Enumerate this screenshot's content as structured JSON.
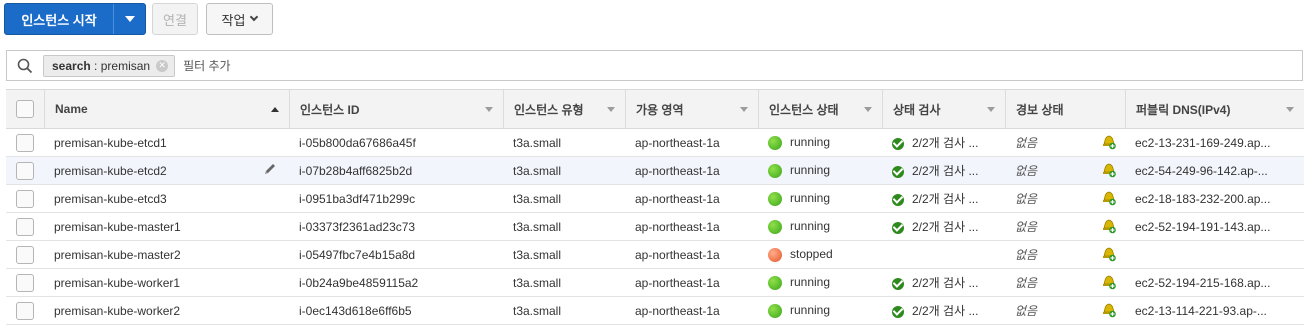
{
  "toolbar": {
    "launch_label": "인스턴스 시작",
    "connect_label": "연결",
    "actions_label": "작업"
  },
  "search": {
    "token_key": "search",
    "token_sep": ":",
    "token_value": "premisan",
    "placeholder": "필터 추가"
  },
  "columns": {
    "name": "Name",
    "instance_id": "인스턴스 ID",
    "instance_type": "인스턴스 유형",
    "az": "가용 영역",
    "instance_state": "인스턴스 상태",
    "status_checks": "상태 검사",
    "alarm_status": "경보 상태",
    "public_dns": "퍼블릭 DNS(IPv4)"
  },
  "rows": [
    {
      "name": "premisan-kube-etcd1",
      "id": "i-05b800da67686a45f",
      "type": "t3a.small",
      "az": "ap-northeast-1a",
      "state": "running",
      "state_color": "#3aa51a",
      "check": "2/2개 검사 ...",
      "alarm": "없음",
      "dns": "ec2-13-231-169-249.ap..."
    },
    {
      "name": "premisan-kube-etcd2",
      "id": "i-07b28b4aff6825b2d",
      "type": "t3a.small",
      "az": "ap-northeast-1a",
      "state": "running",
      "state_color": "#3aa51a",
      "check": "2/2개 검사 ...",
      "alarm": "없음",
      "dns": "ec2-54-249-96-142.ap-..."
    },
    {
      "name": "premisan-kube-etcd3",
      "id": "i-0951ba3df471b299c",
      "type": "t3a.small",
      "az": "ap-northeast-1a",
      "state": "running",
      "state_color": "#3aa51a",
      "check": "2/2개 검사 ...",
      "alarm": "없음",
      "dns": "ec2-18-183-232-200.ap..."
    },
    {
      "name": "premisan-kube-master1",
      "id": "i-03373f2361ad23c73",
      "type": "t3a.small",
      "az": "ap-northeast-1a",
      "state": "running",
      "state_color": "#3aa51a",
      "check": "2/2개 검사 ...",
      "alarm": "없음",
      "dns": "ec2-52-194-191-143.ap..."
    },
    {
      "name": "premisan-kube-master2",
      "id": "i-05497fbc7e4b15a8d",
      "type": "t3a.small",
      "az": "ap-northeast-1a",
      "state": "stopped",
      "state_color": "#e5552b",
      "check": "",
      "alarm": "없음",
      "dns": ""
    },
    {
      "name": "premisan-kube-worker1",
      "id": "i-0b24a9be4859115a2",
      "type": "t3a.small",
      "az": "ap-northeast-1a",
      "state": "running",
      "state_color": "#3aa51a",
      "check": "2/2개 검사 ...",
      "alarm": "없음",
      "dns": "ec2-52-194-215-168.ap..."
    },
    {
      "name": "premisan-kube-worker2",
      "id": "i-0ec143d618e6ff6b5",
      "type": "t3a.small",
      "az": "ap-northeast-1a",
      "state": "running",
      "state_color": "#3aa51a",
      "check": "2/2개 검사 ...",
      "alarm": "없음",
      "dns": "ec2-13-114-221-93.ap-..."
    }
  ],
  "icons": {
    "search": "search-icon",
    "edit": "pencil-icon",
    "alarm": "bell-add-icon"
  },
  "colors": {
    "primary": "#1b6cc8",
    "running": "#3aa51a",
    "stopped": "#e5552b"
  }
}
